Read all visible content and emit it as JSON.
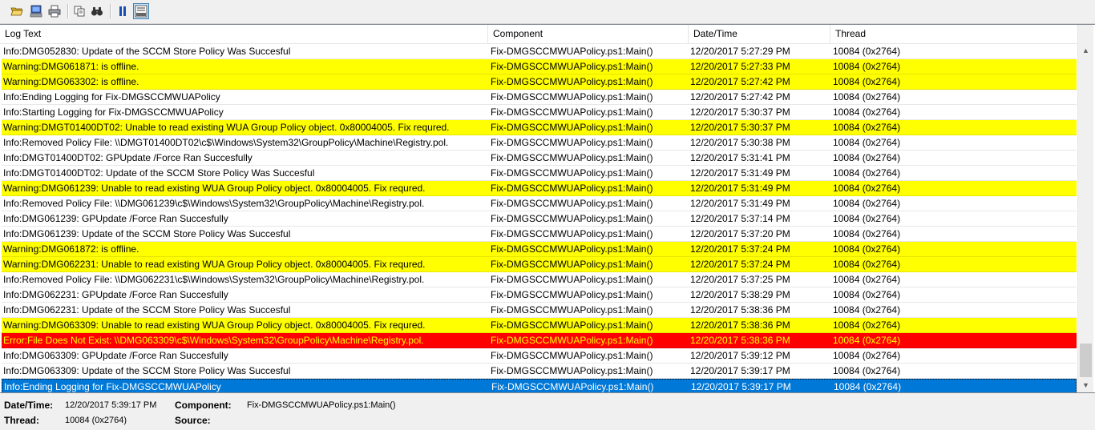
{
  "columns": [
    "Log Text",
    "Component",
    "Date/Time",
    "Thread"
  ],
  "rows": [
    {
      "type": "info",
      "text": "Info:DMG052830: Update of the SCCM Store Policy Was Succesful",
      "component": "Fix-DMGSCCMWUAPolicy.ps1:Main()",
      "datetime": "12/20/2017 5:27:29 PM",
      "thread": "10084 (0x2764)"
    },
    {
      "type": "warning",
      "text": "Warning:DMG061871: is offline.",
      "component": "Fix-DMGSCCMWUAPolicy.ps1:Main()",
      "datetime": "12/20/2017 5:27:33 PM",
      "thread": "10084 (0x2764)"
    },
    {
      "type": "warning",
      "text": "Warning:DMG063302: is offline.",
      "component": "Fix-DMGSCCMWUAPolicy.ps1:Main()",
      "datetime": "12/20/2017 5:27:42 PM",
      "thread": "10084 (0x2764)"
    },
    {
      "type": "info",
      "text": "Info:Ending Logging for Fix-DMGSCCMWUAPolicy",
      "component": "Fix-DMGSCCMWUAPolicy.ps1:Main()",
      "datetime": "12/20/2017 5:27:42 PM",
      "thread": "10084 (0x2764)"
    },
    {
      "type": "info",
      "text": "Info:Starting Logging for Fix-DMGSCCMWUAPolicy",
      "component": "Fix-DMGSCCMWUAPolicy.ps1:Main()",
      "datetime": "12/20/2017 5:30:37 PM",
      "thread": "10084 (0x2764)"
    },
    {
      "type": "warning",
      "text": "Warning:DMGT01400DT02: Unable to read existing WUA Group Policy object. 0x80004005. Fix requred.",
      "component": "Fix-DMGSCCMWUAPolicy.ps1:Main()",
      "datetime": "12/20/2017 5:30:37 PM",
      "thread": "10084 (0x2764)"
    },
    {
      "type": "info",
      "text": "Info:Removed Policy File: \\\\DMGT01400DT02\\c$\\Windows\\System32\\GroupPolicy\\Machine\\Registry.pol.",
      "component": "Fix-DMGSCCMWUAPolicy.ps1:Main()",
      "datetime": "12/20/2017 5:30:38 PM",
      "thread": "10084 (0x2764)"
    },
    {
      "type": "info",
      "text": "Info:DMGT01400DT02: GPUpdate /Force Ran Succesfully",
      "component": "Fix-DMGSCCMWUAPolicy.ps1:Main()",
      "datetime": "12/20/2017 5:31:41 PM",
      "thread": "10084 (0x2764)"
    },
    {
      "type": "info",
      "text": "Info:DMGT01400DT02: Update of the SCCM Store Policy Was Succesful",
      "component": "Fix-DMGSCCMWUAPolicy.ps1:Main()",
      "datetime": "12/20/2017 5:31:49 PM",
      "thread": "10084 (0x2764)"
    },
    {
      "type": "warning",
      "text": "Warning:DMG061239: Unable to read existing WUA Group Policy object. 0x80004005. Fix requred.",
      "component": "Fix-DMGSCCMWUAPolicy.ps1:Main()",
      "datetime": "12/20/2017 5:31:49 PM",
      "thread": "10084 (0x2764)"
    },
    {
      "type": "info",
      "text": "Info:Removed Policy File: \\\\DMG061239\\c$\\Windows\\System32\\GroupPolicy\\Machine\\Registry.pol.",
      "component": "Fix-DMGSCCMWUAPolicy.ps1:Main()",
      "datetime": "12/20/2017 5:31:49 PM",
      "thread": "10084 (0x2764)"
    },
    {
      "type": "info",
      "text": "Info:DMG061239: GPUpdate /Force Ran Succesfully",
      "component": "Fix-DMGSCCMWUAPolicy.ps1:Main()",
      "datetime": "12/20/2017 5:37:14 PM",
      "thread": "10084 (0x2764)"
    },
    {
      "type": "info",
      "text": "Info:DMG061239: Update of the SCCM Store Policy Was Succesful",
      "component": "Fix-DMGSCCMWUAPolicy.ps1:Main()",
      "datetime": "12/20/2017 5:37:20 PM",
      "thread": "10084 (0x2764)"
    },
    {
      "type": "warning",
      "text": "Warning:DMG061872: is offline.",
      "component": "Fix-DMGSCCMWUAPolicy.ps1:Main()",
      "datetime": "12/20/2017 5:37:24 PM",
      "thread": "10084 (0x2764)"
    },
    {
      "type": "warning",
      "text": "Warning:DMG062231: Unable to read existing WUA Group Policy object. 0x80004005. Fix requred.",
      "component": "Fix-DMGSCCMWUAPolicy.ps1:Main()",
      "datetime": "12/20/2017 5:37:24 PM",
      "thread": "10084 (0x2764)"
    },
    {
      "type": "info",
      "text": "Info:Removed Policy File: \\\\DMG062231\\c$\\Windows\\System32\\GroupPolicy\\Machine\\Registry.pol.",
      "component": "Fix-DMGSCCMWUAPolicy.ps1:Main()",
      "datetime": "12/20/2017 5:37:25 PM",
      "thread": "10084 (0x2764)"
    },
    {
      "type": "info",
      "text": "Info:DMG062231: GPUpdate /Force Ran Succesfully",
      "component": "Fix-DMGSCCMWUAPolicy.ps1:Main()",
      "datetime": "12/20/2017 5:38:29 PM",
      "thread": "10084 (0x2764)"
    },
    {
      "type": "info",
      "text": "Info:DMG062231: Update of the SCCM Store Policy Was Succesful",
      "component": "Fix-DMGSCCMWUAPolicy.ps1:Main()",
      "datetime": "12/20/2017 5:38:36 PM",
      "thread": "10084 (0x2764)"
    },
    {
      "type": "warning",
      "text": "Warning:DMG063309: Unable to read existing WUA Group Policy object. 0x80004005. Fix requred.",
      "component": "Fix-DMGSCCMWUAPolicy.ps1:Main()",
      "datetime": "12/20/2017 5:38:36 PM",
      "thread": "10084 (0x2764)"
    },
    {
      "type": "error",
      "text": "Error:File Does Not Exist: \\\\DMG063309\\c$\\Windows\\System32\\GroupPolicy\\Machine\\Registry.pol.",
      "component": "Fix-DMGSCCMWUAPolicy.ps1:Main()",
      "datetime": "12/20/2017 5:38:36 PM",
      "thread": "10084 (0x2764)"
    },
    {
      "type": "info",
      "text": "Info:DMG063309: GPUpdate /Force Ran Succesfully",
      "component": "Fix-DMGSCCMWUAPolicy.ps1:Main()",
      "datetime": "12/20/2017 5:39:12 PM",
      "thread": "10084 (0x2764)"
    },
    {
      "type": "info",
      "text": "Info:DMG063309: Update of the SCCM Store Policy Was Succesful",
      "component": "Fix-DMGSCCMWUAPolicy.ps1:Main()",
      "datetime": "12/20/2017 5:39:17 PM",
      "thread": "10084 (0x2764)"
    },
    {
      "type": "selected",
      "text": "Info:Ending Logging for Fix-DMGSCCMWUAPolicy",
      "component": "Fix-DMGSCCMWUAPolicy.ps1:Main()",
      "datetime": "12/20/2017 5:39:17 PM",
      "thread": "10084 (0x2764)"
    }
  ],
  "details": {
    "datetime_label": "Date/Time:",
    "datetime_value": "12/20/2017 5:39:17 PM",
    "component_label": "Component:",
    "component_value": "Fix-DMGSCCMWUAPolicy.ps1:Main()",
    "thread_label": "Thread:",
    "thread_value": "10084 (0x2764)",
    "source_label": "Source:",
    "source_value": ""
  },
  "toolbar": {
    "icons": [
      "open-folder-icon",
      "computer-icon",
      "print-icon",
      "copy-icon",
      "find-icon",
      "pause-icon",
      "details-pane-icon"
    ]
  },
  "colors": {
    "warning_row": "#ffff00",
    "error_row": "#ff0000",
    "error_text": "#ffff00",
    "selected_row": "#0078d7"
  }
}
